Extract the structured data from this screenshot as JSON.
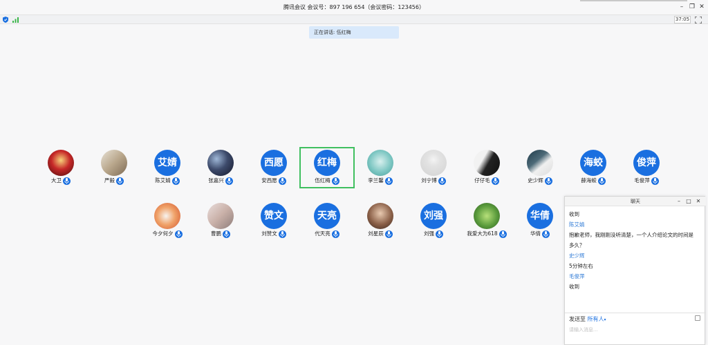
{
  "window": {
    "title": "腾讯会议  会议号：897 196 654（会议密码：123456）",
    "minimize": "–",
    "restore": "❐",
    "close": "✕"
  },
  "status": {
    "timer": "37:05"
  },
  "speaking": {
    "text": "正在讲话: 伍红梅"
  },
  "colors": {
    "accent": "#1a6fe0",
    "active_border": "#3fbf5f"
  },
  "participants": [
    {
      "name": "大卫",
      "avatar_text": "",
      "avatar_kind": "photo",
      "photo": "red-stage"
    },
    {
      "name": "严毅",
      "avatar_text": "",
      "avatar_kind": "photo",
      "photo": "cartoon-heart"
    },
    {
      "name": "陈艾婧",
      "avatar_text": "艾婧",
      "avatar_kind": "blue"
    },
    {
      "name": "张嘉兴",
      "avatar_text": "",
      "avatar_kind": "photo",
      "photo": "space"
    },
    {
      "name": "安西愿",
      "avatar_text": "西愿",
      "avatar_kind": "blue"
    },
    {
      "name": "伍红梅",
      "avatar_text": "红梅",
      "avatar_kind": "blue",
      "active": true
    },
    {
      "name": "李兰馨",
      "avatar_text": "",
      "avatar_kind": "photo",
      "photo": "teal-girl"
    },
    {
      "name": "刘宁博",
      "avatar_text": "",
      "avatar_kind": "photo",
      "photo": "default-gray"
    },
    {
      "name": "仔仔毛",
      "avatar_text": "",
      "avatar_kind": "photo",
      "photo": "bw-portrait"
    },
    {
      "name": "史少辉",
      "avatar_text": "",
      "avatar_kind": "photo",
      "photo": "white-cat"
    },
    {
      "name": "薛海蛟",
      "avatar_text": "海蛟",
      "avatar_kind": "blue"
    },
    {
      "name": "毛俊萍",
      "avatar_text": "俊萍",
      "avatar_kind": "blue"
    },
    {
      "name": "今夕何夕",
      "avatar_text": "",
      "avatar_kind": "photo",
      "photo": "fox"
    },
    {
      "name": "曹鹏",
      "avatar_text": "",
      "avatar_kind": "photo",
      "photo": "person-heart"
    },
    {
      "name": "刘赞文",
      "avatar_text": "赞文",
      "avatar_kind": "blue"
    },
    {
      "name": "代天亮",
      "avatar_text": "天亮",
      "avatar_kind": "blue"
    },
    {
      "name": "刘星辰",
      "avatar_text": "",
      "avatar_kind": "photo",
      "photo": "portrait-brown"
    },
    {
      "name": "刘强",
      "avatar_text": "刘强",
      "avatar_kind": "blue"
    },
    {
      "name": "我爱大为618",
      "avatar_text": "",
      "avatar_kind": "photo",
      "photo": "green-nature"
    },
    {
      "name": "华倩",
      "avatar_text": "华倩",
      "avatar_kind": "blue"
    }
  ],
  "chat": {
    "title": "聊天",
    "minimize": "–",
    "maximize": "□",
    "close": "✕",
    "messages": [
      {
        "kind": "text",
        "text": "收到"
      },
      {
        "kind": "sender",
        "text": "陈艾婧"
      },
      {
        "kind": "text",
        "text": "抱歉老师，我刚刚没听清楚，一个人介绍论文的时间是"
      },
      {
        "kind": "text",
        "text": "多久？"
      },
      {
        "kind": "sender",
        "text": "史少辉"
      },
      {
        "kind": "text",
        "text": "5分钟左右"
      },
      {
        "kind": "sender",
        "text": "毛俊萍"
      },
      {
        "kind": "text",
        "text": "收到"
      }
    ],
    "send_label": "发送至",
    "send_target": "所有人",
    "send_caret": "▾",
    "input_placeholder": "请输入消息..."
  }
}
